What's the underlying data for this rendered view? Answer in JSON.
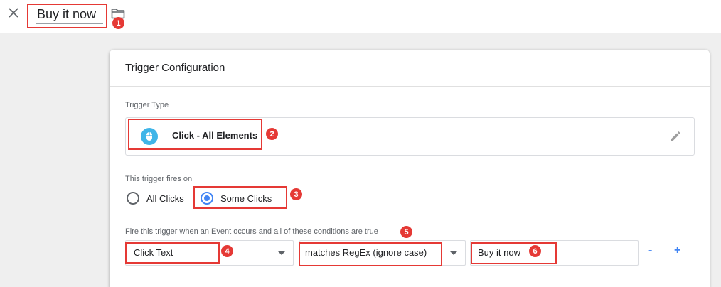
{
  "header": {
    "trigger_name": "Buy it now"
  },
  "card": {
    "title": "Trigger Configuration",
    "trigger_type_label": "Trigger Type",
    "trigger_type_value": "Click - All Elements",
    "fires_on_label": "This trigger fires on",
    "fires_on_options": [
      {
        "label": "All Clicks",
        "selected": false
      },
      {
        "label": "Some Clicks",
        "selected": true
      }
    ],
    "condition_label": "Fire this trigger when an Event occurs and all of these conditions are true",
    "condition": {
      "variable": "Click Text",
      "operator": "matches RegEx (ignore case)",
      "value": "Buy it now"
    },
    "remove_label": "-",
    "add_label": "+"
  },
  "callouts": [
    "1",
    "2",
    "3",
    "4",
    "5",
    "6"
  ],
  "colors": {
    "accent": "#4285f4",
    "callout": "#e53935",
    "click_icon": "#3fb5e8"
  },
  "icons": {
    "close": "close-icon",
    "folder": "folder-icon",
    "click": "mouse-click-icon",
    "edit": "pencil-icon",
    "dropdown": "chevron-down-icon"
  }
}
